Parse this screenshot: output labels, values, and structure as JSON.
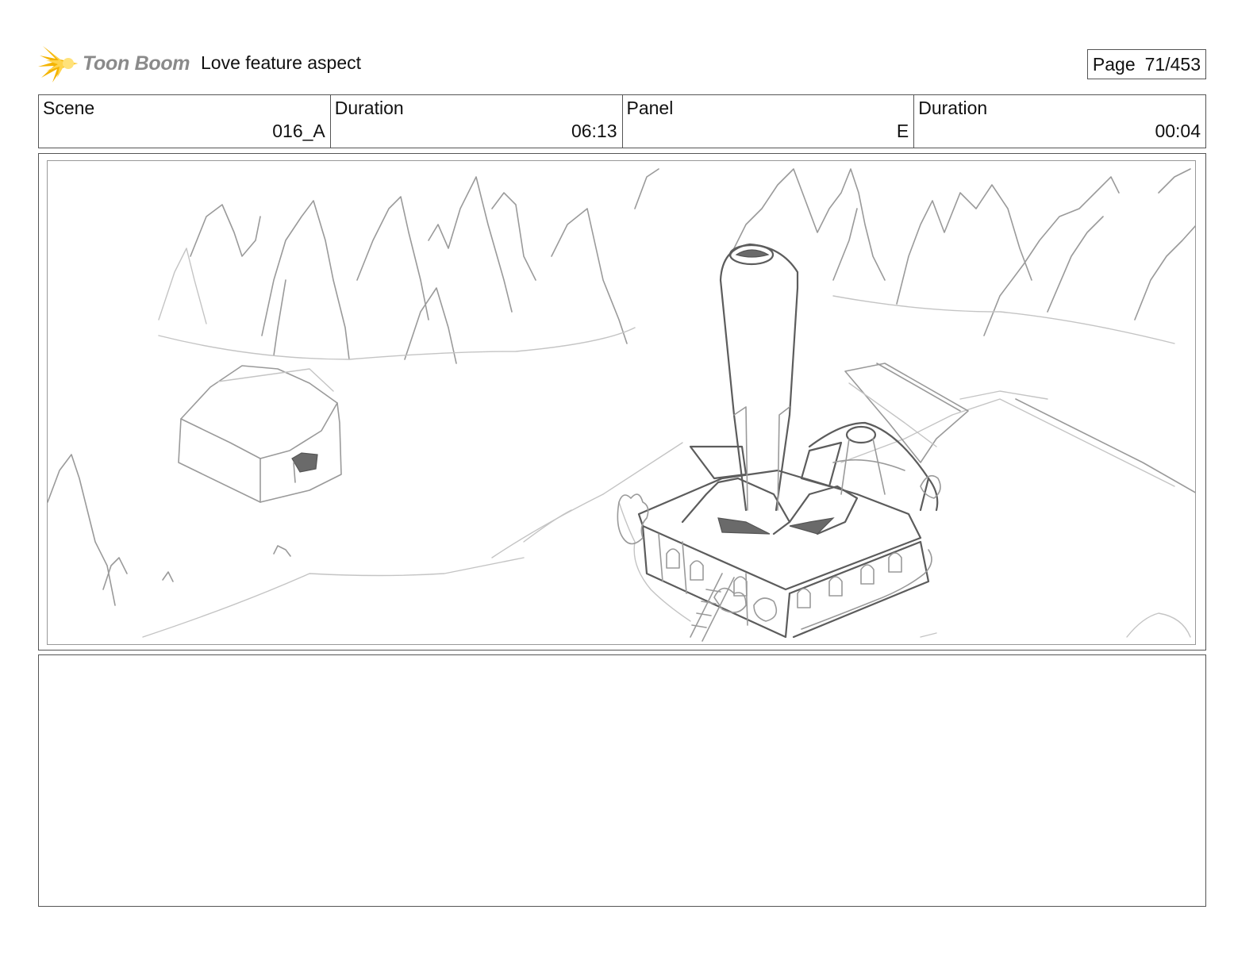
{
  "header": {
    "logo_text": "Toon Boom",
    "project_title": "Love feature aspect",
    "page_label": "Page",
    "page_value": "71/453"
  },
  "info": {
    "scene_label": "Scene",
    "scene_value": "016_A",
    "scene_duration_label": "Duration",
    "scene_duration_value": "06:13",
    "panel_label": "Panel",
    "panel_value": "E",
    "panel_duration_label": "Duration",
    "panel_duration_value": "00:04"
  },
  "panel": {
    "icon": "storyboard-sketch"
  },
  "notes": {}
}
